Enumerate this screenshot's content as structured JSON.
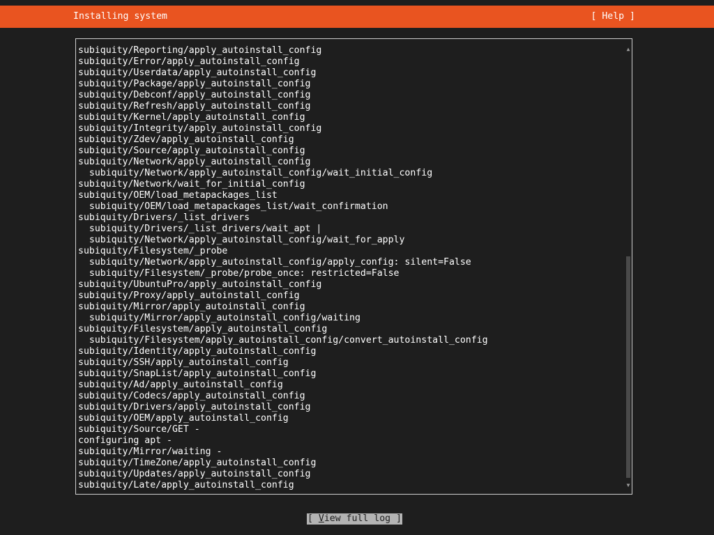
{
  "header": {
    "title": "Installing system",
    "help_label": "[ Help ]",
    "color": "#e95420"
  },
  "log": {
    "lines": [
      "subiquity/Reporting/apply_autoinstall_config",
      "subiquity/Error/apply_autoinstall_config",
      "subiquity/Userdata/apply_autoinstall_config",
      "subiquity/Package/apply_autoinstall_config",
      "subiquity/Debconf/apply_autoinstall_config",
      "subiquity/Refresh/apply_autoinstall_config",
      "subiquity/Kernel/apply_autoinstall_config",
      "subiquity/Integrity/apply_autoinstall_config",
      "subiquity/Zdev/apply_autoinstall_config",
      "subiquity/Source/apply_autoinstall_config",
      "subiquity/Network/apply_autoinstall_config",
      "  subiquity/Network/apply_autoinstall_config/wait_initial_config",
      "subiquity/Network/wait_for_initial_config",
      "subiquity/OEM/load_metapackages_list",
      "  subiquity/OEM/load_metapackages_list/wait_confirmation",
      "subiquity/Drivers/_list_drivers",
      "  subiquity/Drivers/_list_drivers/wait_apt |",
      "  subiquity/Network/apply_autoinstall_config/wait_for_apply",
      "subiquity/Filesystem/_probe",
      "  subiquity/Network/apply_autoinstall_config/apply_config: silent=False",
      "  subiquity/Filesystem/_probe/probe_once: restricted=False",
      "subiquity/UbuntuPro/apply_autoinstall_config",
      "subiquity/Proxy/apply_autoinstall_config",
      "subiquity/Mirror/apply_autoinstall_config",
      "  subiquity/Mirror/apply_autoinstall_config/waiting",
      "subiquity/Filesystem/apply_autoinstall_config",
      "  subiquity/Filesystem/apply_autoinstall_config/convert_autoinstall_config",
      "subiquity/Identity/apply_autoinstall_config",
      "subiquity/SSH/apply_autoinstall_config",
      "subiquity/SnapList/apply_autoinstall_config",
      "subiquity/Ad/apply_autoinstall_config",
      "subiquity/Codecs/apply_autoinstall_config",
      "subiquity/Drivers/apply_autoinstall_config",
      "subiquity/OEM/apply_autoinstall_config",
      "subiquity/Source/GET -",
      "configuring apt -",
      "subiquity/Mirror/waiting -",
      "subiquity/TimeZone/apply_autoinstall_config",
      "subiquity/Updates/apply_autoinstall_config",
      "subiquity/Late/apply_autoinstall_config"
    ]
  },
  "scrollbar": {
    "up_glyph": "▲",
    "down_glyph": "▼"
  },
  "footer": {
    "view_log_open": "[ ",
    "view_log_hotkey": "V",
    "view_log_rest": "iew full log ]"
  }
}
